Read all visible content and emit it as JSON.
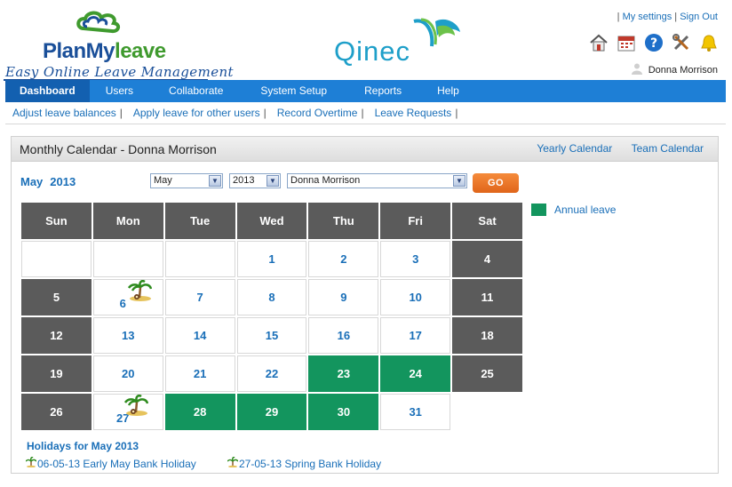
{
  "brand": {
    "name_part1": "PlanMy",
    "name_part2": "leave",
    "tagline": "Easy Online Leave Management",
    "partner": "Qinec"
  },
  "toplinks": {
    "settings": "My settings",
    "signout": "Sign Out"
  },
  "user": {
    "name": "Donna Morrison"
  },
  "icons": [
    "home-icon",
    "calendar-icon",
    "help-icon",
    "tools-icon",
    "bell-icon"
  ],
  "nav": {
    "items": [
      {
        "label": "Dashboard",
        "active": true
      },
      {
        "label": "Users"
      },
      {
        "label": "Collaborate"
      },
      {
        "label": "System Setup"
      },
      {
        "label": "Reports"
      },
      {
        "label": "Help"
      }
    ]
  },
  "subnav": {
    "items": [
      "Adjust leave balances",
      "Apply leave for other users",
      "Record Overtime",
      "Leave Requests"
    ]
  },
  "panel": {
    "title": "Monthly Calendar - Donna Morrison",
    "links": [
      "Yearly Calendar",
      "Team Calendar"
    ],
    "month": "May",
    "year": "2013",
    "selects": {
      "month": "May",
      "year": "2013",
      "user": "Donna Morrison"
    },
    "go_label": "GO"
  },
  "calendar": {
    "weekdays": [
      "Sun",
      "Mon",
      "Tue",
      "Wed",
      "Thu",
      "Fri",
      "Sat"
    ],
    "weeks": [
      [
        {
          "d": ""
        },
        {
          "d": ""
        },
        {
          "d": ""
        },
        {
          "d": "1"
        },
        {
          "d": "2"
        },
        {
          "d": "3"
        },
        {
          "d": "4",
          "t": "wkend"
        }
      ],
      [
        {
          "d": "5",
          "t": "wkend"
        },
        {
          "d": "6",
          "t": "holiday"
        },
        {
          "d": "7"
        },
        {
          "d": "8"
        },
        {
          "d": "9"
        },
        {
          "d": "10"
        },
        {
          "d": "11",
          "t": "wkend"
        }
      ],
      [
        {
          "d": "12",
          "t": "wkend"
        },
        {
          "d": "13"
        },
        {
          "d": "14"
        },
        {
          "d": "15"
        },
        {
          "d": "16"
        },
        {
          "d": "17"
        },
        {
          "d": "18",
          "t": "wkend"
        }
      ],
      [
        {
          "d": "19",
          "t": "wkend"
        },
        {
          "d": "20"
        },
        {
          "d": "21"
        },
        {
          "d": "22"
        },
        {
          "d": "23",
          "t": "leave"
        },
        {
          "d": "24",
          "t": "leave"
        },
        {
          "d": "25",
          "t": "wkend"
        }
      ],
      [
        {
          "d": "26",
          "t": "wkend"
        },
        {
          "d": "27",
          "t": "holiday"
        },
        {
          "d": "28",
          "t": "leave"
        },
        {
          "d": "29",
          "t": "leave"
        },
        {
          "d": "30",
          "t": "leave"
        },
        {
          "d": "31"
        },
        {
          "d": "",
          "t": "blank"
        }
      ]
    ],
    "legend": {
      "label": "Annual leave",
      "color": "#13955e"
    }
  },
  "holidays": {
    "title": "Holidays for May 2013",
    "items": [
      "06-05-13 Early May Bank Holiday",
      "27-05-13 Spring Bank Holiday"
    ]
  }
}
